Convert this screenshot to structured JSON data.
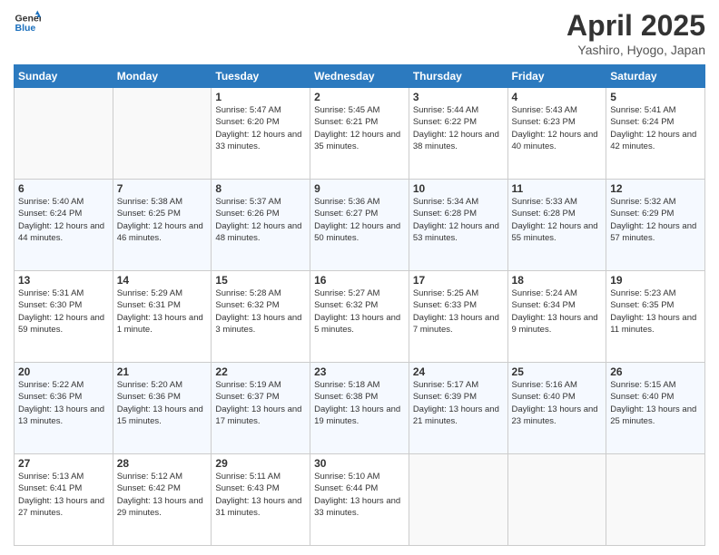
{
  "logo": {
    "line1": "General",
    "line2": "Blue"
  },
  "title": "April 2025",
  "subtitle": "Yashiro, Hyogo, Japan",
  "weekdays": [
    "Sunday",
    "Monday",
    "Tuesday",
    "Wednesday",
    "Thursday",
    "Friday",
    "Saturday"
  ],
  "weeks": [
    [
      {
        "day": "",
        "info": ""
      },
      {
        "day": "",
        "info": ""
      },
      {
        "day": "1",
        "info": "Sunrise: 5:47 AM\nSunset: 6:20 PM\nDaylight: 12 hours and 33 minutes."
      },
      {
        "day": "2",
        "info": "Sunrise: 5:45 AM\nSunset: 6:21 PM\nDaylight: 12 hours and 35 minutes."
      },
      {
        "day": "3",
        "info": "Sunrise: 5:44 AM\nSunset: 6:22 PM\nDaylight: 12 hours and 38 minutes."
      },
      {
        "day": "4",
        "info": "Sunrise: 5:43 AM\nSunset: 6:23 PM\nDaylight: 12 hours and 40 minutes."
      },
      {
        "day": "5",
        "info": "Sunrise: 5:41 AM\nSunset: 6:24 PM\nDaylight: 12 hours and 42 minutes."
      }
    ],
    [
      {
        "day": "6",
        "info": "Sunrise: 5:40 AM\nSunset: 6:24 PM\nDaylight: 12 hours and 44 minutes."
      },
      {
        "day": "7",
        "info": "Sunrise: 5:38 AM\nSunset: 6:25 PM\nDaylight: 12 hours and 46 minutes."
      },
      {
        "day": "8",
        "info": "Sunrise: 5:37 AM\nSunset: 6:26 PM\nDaylight: 12 hours and 48 minutes."
      },
      {
        "day": "9",
        "info": "Sunrise: 5:36 AM\nSunset: 6:27 PM\nDaylight: 12 hours and 50 minutes."
      },
      {
        "day": "10",
        "info": "Sunrise: 5:34 AM\nSunset: 6:28 PM\nDaylight: 12 hours and 53 minutes."
      },
      {
        "day": "11",
        "info": "Sunrise: 5:33 AM\nSunset: 6:28 PM\nDaylight: 12 hours and 55 minutes."
      },
      {
        "day": "12",
        "info": "Sunrise: 5:32 AM\nSunset: 6:29 PM\nDaylight: 12 hours and 57 minutes."
      }
    ],
    [
      {
        "day": "13",
        "info": "Sunrise: 5:31 AM\nSunset: 6:30 PM\nDaylight: 12 hours and 59 minutes."
      },
      {
        "day": "14",
        "info": "Sunrise: 5:29 AM\nSunset: 6:31 PM\nDaylight: 13 hours and 1 minute."
      },
      {
        "day": "15",
        "info": "Sunrise: 5:28 AM\nSunset: 6:32 PM\nDaylight: 13 hours and 3 minutes."
      },
      {
        "day": "16",
        "info": "Sunrise: 5:27 AM\nSunset: 6:32 PM\nDaylight: 13 hours and 5 minutes."
      },
      {
        "day": "17",
        "info": "Sunrise: 5:25 AM\nSunset: 6:33 PM\nDaylight: 13 hours and 7 minutes."
      },
      {
        "day": "18",
        "info": "Sunrise: 5:24 AM\nSunset: 6:34 PM\nDaylight: 13 hours and 9 minutes."
      },
      {
        "day": "19",
        "info": "Sunrise: 5:23 AM\nSunset: 6:35 PM\nDaylight: 13 hours and 11 minutes."
      }
    ],
    [
      {
        "day": "20",
        "info": "Sunrise: 5:22 AM\nSunset: 6:36 PM\nDaylight: 13 hours and 13 minutes."
      },
      {
        "day": "21",
        "info": "Sunrise: 5:20 AM\nSunset: 6:36 PM\nDaylight: 13 hours and 15 minutes."
      },
      {
        "day": "22",
        "info": "Sunrise: 5:19 AM\nSunset: 6:37 PM\nDaylight: 13 hours and 17 minutes."
      },
      {
        "day": "23",
        "info": "Sunrise: 5:18 AM\nSunset: 6:38 PM\nDaylight: 13 hours and 19 minutes."
      },
      {
        "day": "24",
        "info": "Sunrise: 5:17 AM\nSunset: 6:39 PM\nDaylight: 13 hours and 21 minutes."
      },
      {
        "day": "25",
        "info": "Sunrise: 5:16 AM\nSunset: 6:40 PM\nDaylight: 13 hours and 23 minutes."
      },
      {
        "day": "26",
        "info": "Sunrise: 5:15 AM\nSunset: 6:40 PM\nDaylight: 13 hours and 25 minutes."
      }
    ],
    [
      {
        "day": "27",
        "info": "Sunrise: 5:13 AM\nSunset: 6:41 PM\nDaylight: 13 hours and 27 minutes."
      },
      {
        "day": "28",
        "info": "Sunrise: 5:12 AM\nSunset: 6:42 PM\nDaylight: 13 hours and 29 minutes."
      },
      {
        "day": "29",
        "info": "Sunrise: 5:11 AM\nSunset: 6:43 PM\nDaylight: 13 hours and 31 minutes."
      },
      {
        "day": "30",
        "info": "Sunrise: 5:10 AM\nSunset: 6:44 PM\nDaylight: 13 hours and 33 minutes."
      },
      {
        "day": "",
        "info": ""
      },
      {
        "day": "",
        "info": ""
      },
      {
        "day": "",
        "info": ""
      }
    ]
  ]
}
